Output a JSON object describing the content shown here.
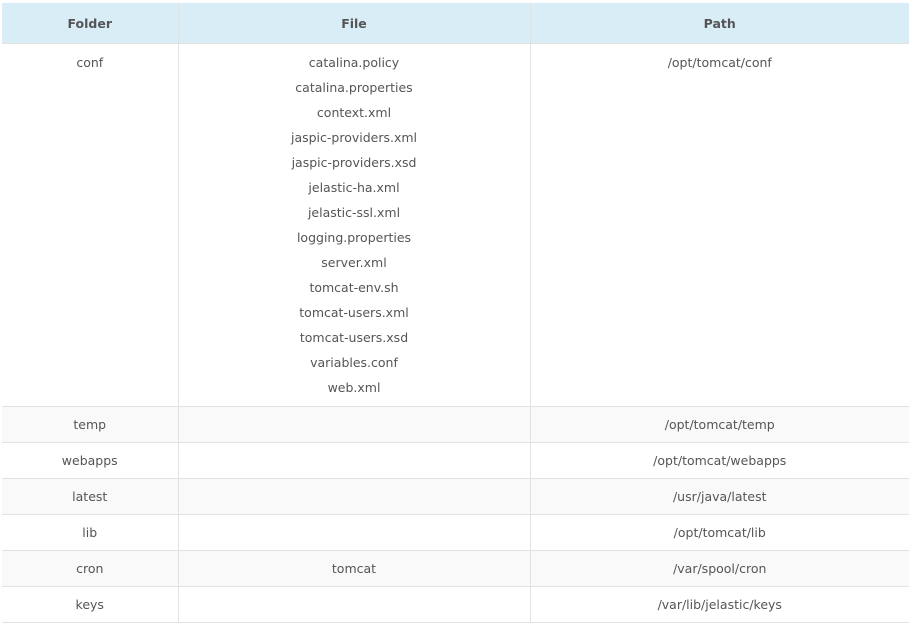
{
  "table": {
    "headers": [
      "Folder",
      "File",
      "Path"
    ],
    "rows": [
      {
        "folder": "conf",
        "files": [
          "catalina.policy",
          "catalina.properties",
          "context.xml",
          "jaspic-providers.xml",
          "jaspic-providers.xsd",
          "jelastic-ha.xml",
          "jelastic-ssl.xml",
          "logging.properties",
          "server.xml",
          "tomcat-env.sh",
          "tomcat-users.xml",
          "tomcat-users.xsd",
          "variables.conf",
          "web.xml"
        ],
        "path": "/opt/tomcat/conf"
      },
      {
        "folder": "temp",
        "file": "",
        "path": "/opt/tomcat/temp"
      },
      {
        "folder": "webapps",
        "file": "",
        "path": "/opt/tomcat/webapps"
      },
      {
        "folder": "latest",
        "file": "",
        "path": "/usr/java/latest"
      },
      {
        "folder": "lib",
        "file": "",
        "path": "/opt/tomcat/lib"
      },
      {
        "folder": "cron",
        "file": "tomcat",
        "path": "/var/spool/cron"
      },
      {
        "folder": "keys",
        "file": "",
        "path": "/var/lib/jelastic/keys"
      }
    ]
  }
}
